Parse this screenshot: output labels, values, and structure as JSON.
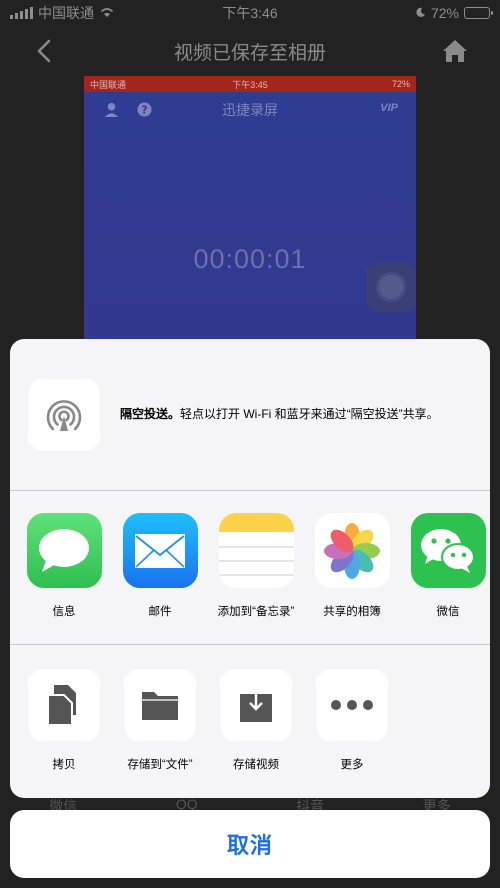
{
  "status_bar": {
    "carrier": "中国联通",
    "time": "下午3:46",
    "battery": "72%",
    "battery_level": 0.72,
    "battery_color": "#3fb24a"
  },
  "nav": {
    "title": "视频已保存至相册",
    "back_icon": "chevron-left-icon",
    "home_icon": "home-icon"
  },
  "preview": {
    "status_carrier": "中国联通",
    "status_time": "下午3:45",
    "status_battery": "72%",
    "app_title": "迅捷录屏",
    "vip_label": "VIP",
    "timer": "00:00:01"
  },
  "background_tabs": [
    "微信",
    "QQ",
    "抖音",
    "更多"
  ],
  "share_sheet": {
    "airdrop": {
      "title": "隔空投送。",
      "description": "轻点以打开 Wi-Fi 和蓝牙来通过“隔空投送”共享。"
    },
    "apps": [
      {
        "label": "信息",
        "icon": "messages-icon",
        "color": "#32c35a"
      },
      {
        "label": "邮件",
        "icon": "mail-icon",
        "color": "#1a8cf5"
      },
      {
        "label": "添加到“备忘录”",
        "icon": "notes-icon",
        "color": "#fbd248"
      },
      {
        "label": "共享的相簿",
        "icon": "photos-icon",
        "color": "#ffffff"
      },
      {
        "label": "微信",
        "icon": "wechat-icon",
        "color": "#2dc14f"
      }
    ],
    "actions": [
      {
        "label": "拷贝",
        "icon": "copy-icon"
      },
      {
        "label": "存储到“文件”",
        "icon": "folder-icon"
      },
      {
        "label": "存储视频",
        "icon": "save-download-icon"
      },
      {
        "label": "更多",
        "icon": "more-icon"
      }
    ]
  },
  "cancel_label": "取消",
  "accent_color": "#1a6fe8"
}
